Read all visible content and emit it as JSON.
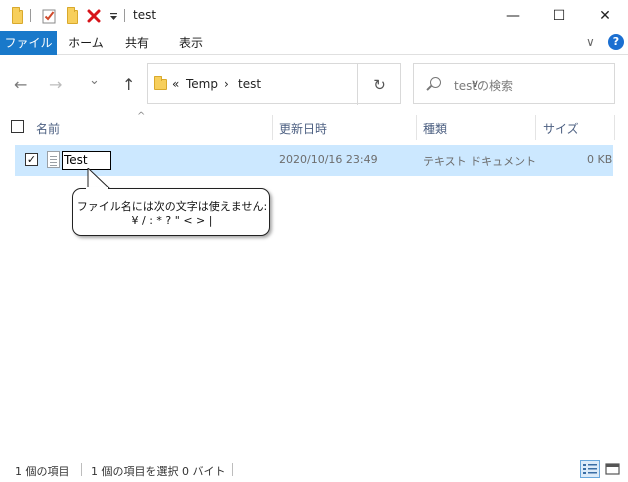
{
  "window": {
    "title": "test",
    "controls": {
      "minimize": "—",
      "maximize": "☐",
      "close": "✕"
    }
  },
  "quick_access": {
    "icons": [
      "folder-icon",
      "properties-check-icon",
      "new-folder-icon",
      "delete-x-icon",
      "customize-dropdown-icon"
    ],
    "colors": {
      "folder": "#f7cf5c",
      "delete": "#d7141a",
      "check": "#d04a2c"
    }
  },
  "ribbon": {
    "tabs": [
      "ファイル",
      "ホーム",
      "共有",
      "表示"
    ],
    "active_color": "#1979ca",
    "expand_chevron": "∨",
    "help": "?"
  },
  "nav": {
    "back": "←",
    "forward": "→",
    "recent": "⌄",
    "up": "↑",
    "breadcrumb": {
      "overflow": "«",
      "parts": [
        "Temp",
        "test"
      ],
      "separator": "›"
    },
    "address_dropdown": "∨",
    "refresh": "↻",
    "search_placeholder": "testの検索"
  },
  "columns": {
    "name": "名前",
    "modified": "更新日時",
    "type": "種類",
    "size": "サイズ",
    "sort_indicator": "^"
  },
  "files": [
    {
      "name": "Test",
      "modified": "2020/10/16 23:49",
      "type": "テキスト ドキュメント",
      "size": "0 KB",
      "selected": true,
      "checked": "✓"
    }
  ],
  "tooltip": {
    "line1": "ファイル名には次の文字は使えません:",
    "line2": "¥ / : * ? \" < > |"
  },
  "status": {
    "item_count": "1 個の項目",
    "selection": "1 個の項目を選択  0 バイト"
  },
  "view": {
    "buttons": [
      "details-view-icon",
      "large-icons-view-icon"
    ],
    "active": "details-view-icon"
  }
}
